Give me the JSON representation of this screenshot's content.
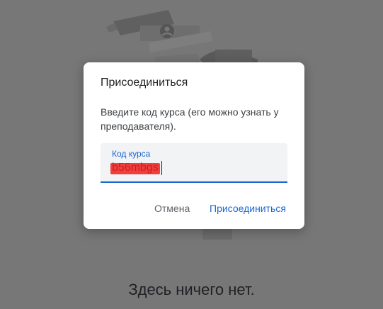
{
  "dialog": {
    "title": "Присоединиться",
    "description": "Введите код курса (его можно узнать у преподавателя).",
    "field": {
      "label": "Код курса",
      "value": "b56mbgs"
    },
    "cancel_label": "Отмена",
    "join_label": "Присоединиться"
  },
  "page": {
    "empty_message": "Здесь ничего нет."
  },
  "colors": {
    "accent": "#1967d2",
    "overlay": "#777777"
  }
}
